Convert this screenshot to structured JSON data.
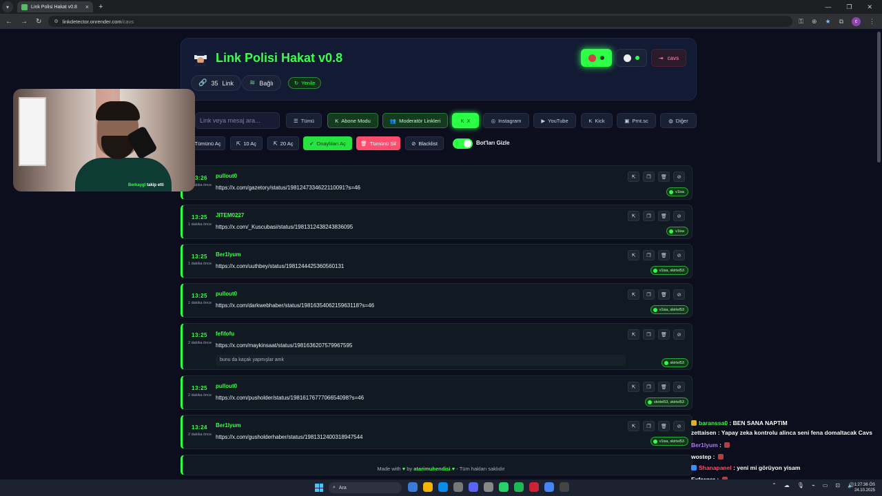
{
  "browser": {
    "tab_title": "Link Polisi Hakat v0.8",
    "url_domain": "linkdetector.onrender.com",
    "url_path": "/cavs"
  },
  "app": {
    "title": "Link Polisi Hakat v0.8",
    "link_count": "35",
    "link_label": "Link",
    "connection": "Bağlı",
    "refresh": "Yenile",
    "user": "cavs"
  },
  "search": {
    "placeholder": "Link veya mesaj ara..."
  },
  "filters": [
    "Tümü",
    "Abone Modu",
    "Moderatör Linkleri",
    "X",
    "Instagram",
    "YouTube",
    "Kick",
    "Prnt.sc",
    "Diğer"
  ],
  "actions": [
    "Tümünü Aç",
    "10 Aç",
    "20 Aç",
    "Onaylıları Aç",
    "Tümünü Sil",
    "Blacklist"
  ],
  "hide_bots": {
    "label": "Bot'ları Gizle",
    "on": true
  },
  "rows": [
    {
      "time": "13:26",
      "ago": "1 dakika önce",
      "user": "pullout0",
      "link": "https://x.com/gazetory/status/1981247334622110091?s=46",
      "msg": "",
      "tags": "v1isa"
    },
    {
      "time": "13:25",
      "ago": "1 dakika önce",
      "user": "JITEM0227",
      "link": "https://x.com/_Kuscubasi/status/1981312438243836095",
      "msg": "",
      "tags": "v1isa"
    },
    {
      "time": "13:25",
      "ago": "1 dakika önce",
      "user": "Ber1lyum",
      "link": "https://x.com/uuthbey/status/1981244425360560131",
      "msg": "",
      "tags": "v1isa, skirtel53"
    },
    {
      "time": "13:25",
      "ago": "1 dakika önce",
      "user": "pullout0",
      "link": "https://x.com/darkwebhaber/status/1981635406215963118?s=46",
      "msg": "",
      "tags": "v1isa, skirtel53"
    },
    {
      "time": "13:25",
      "ago": "2 dakika önce",
      "user": "fefifofu",
      "link": "https://x.com/maykinsaat/status/1981636207579967595",
      "msg": "bunu da kaçak yapmışlar amk",
      "tags": "skirtel53"
    },
    {
      "time": "13:25",
      "ago": "2 dakika önce",
      "user": "pullout0",
      "link": "https://x.com/pusholder/status/1981617677706654098?s=46",
      "msg": "",
      "tags": "skirtel53, skirtel53"
    },
    {
      "time": "13:24",
      "ago": "2 dakika önce",
      "user": "Ber1lyum",
      "link": "https://x.com/gusholderhaber/status/1981312400318947544",
      "msg": "",
      "tags": "v1isa, skirtel53"
    }
  ],
  "footer": {
    "made_with": "Made with",
    "by": "by",
    "author": "atarimuhendisi",
    "rights": "- Tüm hakları saklıdır"
  },
  "webcam": {
    "caption_name": "Berkaygl",
    "caption_rest": "takip etti"
  },
  "chat": [
    {
      "user": "baranssa0",
      "color": "#39ff4a",
      "text": "BEN SANA NAPTIM"
    },
    {
      "user": "zettaisen",
      "color": "#ffffff",
      "text": "Yapay zeka kontrolu alinca seni fena domaltacak Cavs"
    },
    {
      "user": "Ber1lyum",
      "color": "#b07cff",
      "text": ""
    },
    {
      "user": "wostep",
      "color": "#ffffff",
      "text": ""
    },
    {
      "user": "Shanapanel",
      "color": "#ff4d6d",
      "text": "yeni mi görüyon yisam"
    },
    {
      "user": "Exforger",
      "color": "#ffffff",
      "text": ""
    }
  ],
  "taskbar": {
    "search": "Ara",
    "time": "1:27:36 ÖS",
    "date": "24.10.2025"
  },
  "colors": {
    "accent": "#39ff4a",
    "danger": "#ff4d6d",
    "background": "#0c0e1e"
  }
}
